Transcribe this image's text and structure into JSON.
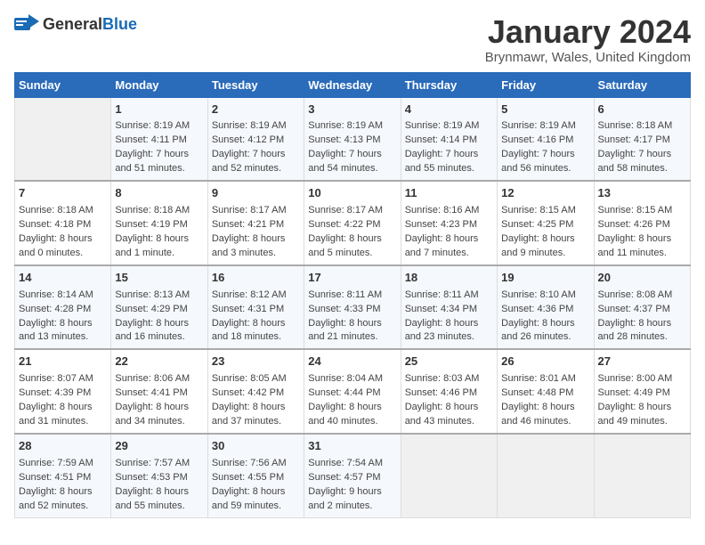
{
  "header": {
    "logo_general": "General",
    "logo_blue": "Blue",
    "title": "January 2024",
    "subtitle": "Brynmawr, Wales, United Kingdom"
  },
  "columns": [
    "Sunday",
    "Monday",
    "Tuesday",
    "Wednesday",
    "Thursday",
    "Friday",
    "Saturday"
  ],
  "weeks": [
    [
      {
        "day": "",
        "info": ""
      },
      {
        "day": "1",
        "info": "Sunrise: 8:19 AM\nSunset: 4:11 PM\nDaylight: 7 hours\nand 51 minutes."
      },
      {
        "day": "2",
        "info": "Sunrise: 8:19 AM\nSunset: 4:12 PM\nDaylight: 7 hours\nand 52 minutes."
      },
      {
        "day": "3",
        "info": "Sunrise: 8:19 AM\nSunset: 4:13 PM\nDaylight: 7 hours\nand 54 minutes."
      },
      {
        "day": "4",
        "info": "Sunrise: 8:19 AM\nSunset: 4:14 PM\nDaylight: 7 hours\nand 55 minutes."
      },
      {
        "day": "5",
        "info": "Sunrise: 8:19 AM\nSunset: 4:16 PM\nDaylight: 7 hours\nand 56 minutes."
      },
      {
        "day": "6",
        "info": "Sunrise: 8:18 AM\nSunset: 4:17 PM\nDaylight: 7 hours\nand 58 minutes."
      }
    ],
    [
      {
        "day": "7",
        "info": "Sunrise: 8:18 AM\nSunset: 4:18 PM\nDaylight: 8 hours\nand 0 minutes."
      },
      {
        "day": "8",
        "info": "Sunrise: 8:18 AM\nSunset: 4:19 PM\nDaylight: 8 hours\nand 1 minute."
      },
      {
        "day": "9",
        "info": "Sunrise: 8:17 AM\nSunset: 4:21 PM\nDaylight: 8 hours\nand 3 minutes."
      },
      {
        "day": "10",
        "info": "Sunrise: 8:17 AM\nSunset: 4:22 PM\nDaylight: 8 hours\nand 5 minutes."
      },
      {
        "day": "11",
        "info": "Sunrise: 8:16 AM\nSunset: 4:23 PM\nDaylight: 8 hours\nand 7 minutes."
      },
      {
        "day": "12",
        "info": "Sunrise: 8:15 AM\nSunset: 4:25 PM\nDaylight: 8 hours\nand 9 minutes."
      },
      {
        "day": "13",
        "info": "Sunrise: 8:15 AM\nSunset: 4:26 PM\nDaylight: 8 hours\nand 11 minutes."
      }
    ],
    [
      {
        "day": "14",
        "info": "Sunrise: 8:14 AM\nSunset: 4:28 PM\nDaylight: 8 hours\nand 13 minutes."
      },
      {
        "day": "15",
        "info": "Sunrise: 8:13 AM\nSunset: 4:29 PM\nDaylight: 8 hours\nand 16 minutes."
      },
      {
        "day": "16",
        "info": "Sunrise: 8:12 AM\nSunset: 4:31 PM\nDaylight: 8 hours\nand 18 minutes."
      },
      {
        "day": "17",
        "info": "Sunrise: 8:11 AM\nSunset: 4:33 PM\nDaylight: 8 hours\nand 21 minutes."
      },
      {
        "day": "18",
        "info": "Sunrise: 8:11 AM\nSunset: 4:34 PM\nDaylight: 8 hours\nand 23 minutes."
      },
      {
        "day": "19",
        "info": "Sunrise: 8:10 AM\nSunset: 4:36 PM\nDaylight: 8 hours\nand 26 minutes."
      },
      {
        "day": "20",
        "info": "Sunrise: 8:08 AM\nSunset: 4:37 PM\nDaylight: 8 hours\nand 28 minutes."
      }
    ],
    [
      {
        "day": "21",
        "info": "Sunrise: 8:07 AM\nSunset: 4:39 PM\nDaylight: 8 hours\nand 31 minutes."
      },
      {
        "day": "22",
        "info": "Sunrise: 8:06 AM\nSunset: 4:41 PM\nDaylight: 8 hours\nand 34 minutes."
      },
      {
        "day": "23",
        "info": "Sunrise: 8:05 AM\nSunset: 4:42 PM\nDaylight: 8 hours\nand 37 minutes."
      },
      {
        "day": "24",
        "info": "Sunrise: 8:04 AM\nSunset: 4:44 PM\nDaylight: 8 hours\nand 40 minutes."
      },
      {
        "day": "25",
        "info": "Sunrise: 8:03 AM\nSunset: 4:46 PM\nDaylight: 8 hours\nand 43 minutes."
      },
      {
        "day": "26",
        "info": "Sunrise: 8:01 AM\nSunset: 4:48 PM\nDaylight: 8 hours\nand 46 minutes."
      },
      {
        "day": "27",
        "info": "Sunrise: 8:00 AM\nSunset: 4:49 PM\nDaylight: 8 hours\nand 49 minutes."
      }
    ],
    [
      {
        "day": "28",
        "info": "Sunrise: 7:59 AM\nSunset: 4:51 PM\nDaylight: 8 hours\nand 52 minutes."
      },
      {
        "day": "29",
        "info": "Sunrise: 7:57 AM\nSunset: 4:53 PM\nDaylight: 8 hours\nand 55 minutes."
      },
      {
        "day": "30",
        "info": "Sunrise: 7:56 AM\nSunset: 4:55 PM\nDaylight: 8 hours\nand 59 minutes."
      },
      {
        "day": "31",
        "info": "Sunrise: 7:54 AM\nSunset: 4:57 PM\nDaylight: 9 hours\nand 2 minutes."
      },
      {
        "day": "",
        "info": ""
      },
      {
        "day": "",
        "info": ""
      },
      {
        "day": "",
        "info": ""
      }
    ]
  ]
}
